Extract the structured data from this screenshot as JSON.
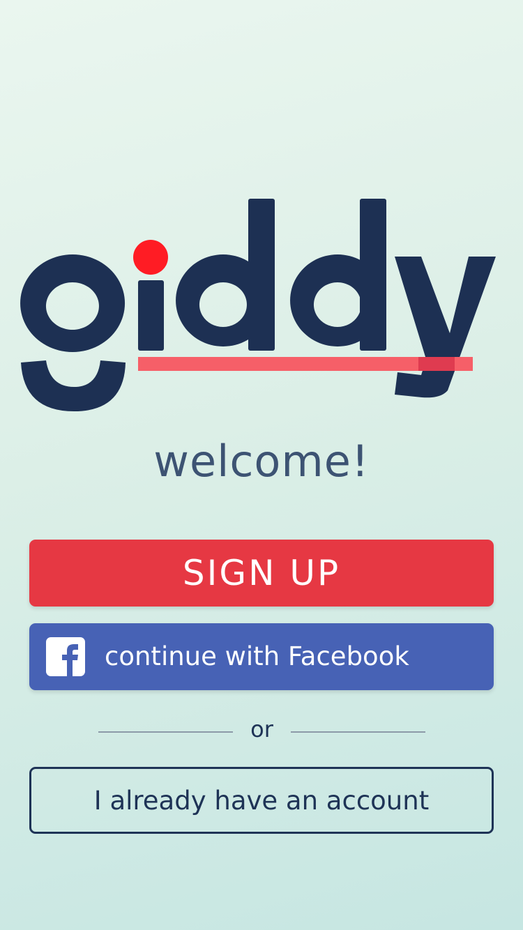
{
  "logo": {
    "text": "giddy",
    "dot_color": "#ff1c24",
    "text_color": "#1d3053",
    "underline_color": "#f65f68"
  },
  "welcome_text": "welcome!",
  "buttons": {
    "signup_label": "SIGN UP",
    "facebook_label": "continue with Facebook",
    "facebook_icon": "facebook-icon",
    "login_label": "I already have an account"
  },
  "divider_text": "or",
  "colors": {
    "signup_bg": "#e63843",
    "facebook_bg": "#4762b5",
    "navy": "#1e3356",
    "welcome": "#3d5373"
  }
}
